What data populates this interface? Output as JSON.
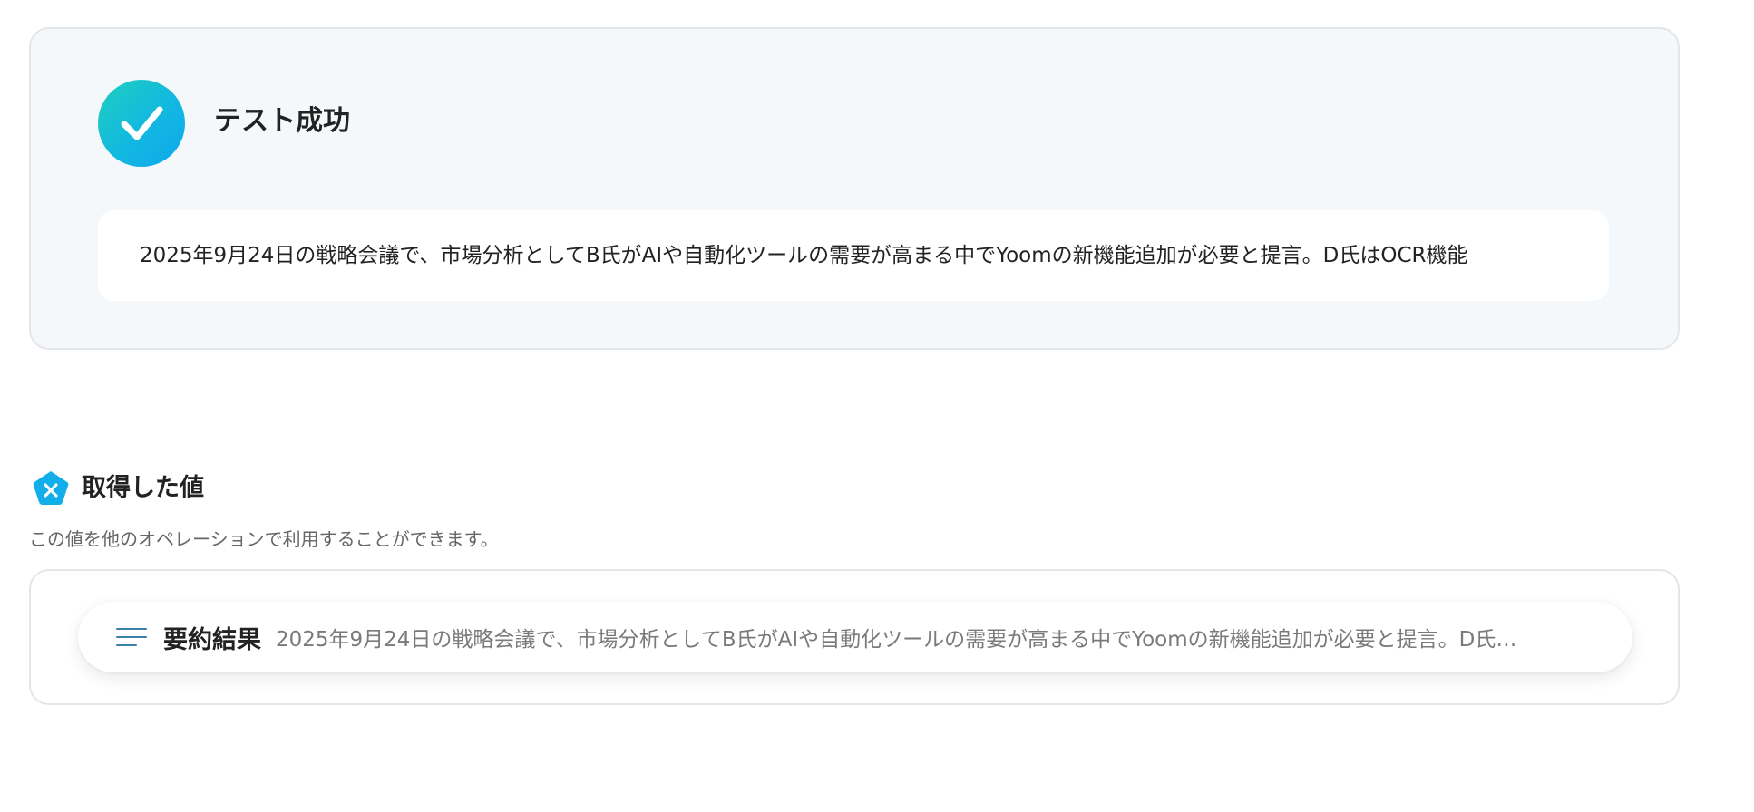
{
  "test_result": {
    "status_label": "テスト成功",
    "output_text": "2025年9月24日の戦略会議で、市場分析としてB氏がAIや自動化ツールの需要が高まる中でYoomの新機能追加が必要と提言。D氏はOCR機能"
  },
  "obtained_values": {
    "title": "取得した値",
    "description": "この値を他のオペレーションで利用することができます。",
    "items": [
      {
        "label": "要約結果",
        "value": "2025年9月24日の戦略会議で、市場分析としてB氏がAIや自動化ツールの需要が高まる中でYoomの新機能追加が必要と提言。D氏…"
      }
    ]
  },
  "icons": {
    "success": "check-circle-icon",
    "values": "variable-pentagon-icon",
    "item": "text-lines-icon"
  },
  "colors": {
    "success_gradient_start": "#1fcfbf",
    "success_gradient_end": "#0fa8ee",
    "values_icon": "#12aeea",
    "lines_icon": "#3a7fa8",
    "panel_background": "#f5f8fb"
  }
}
